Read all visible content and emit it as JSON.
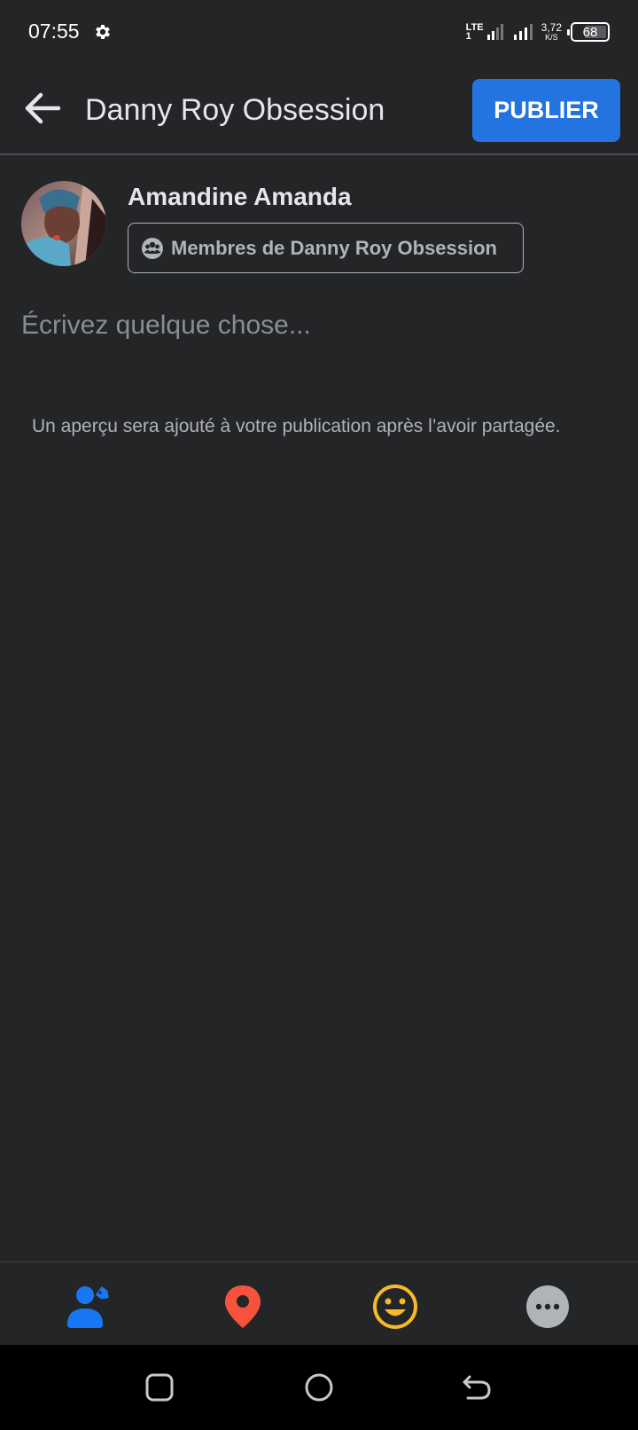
{
  "status_bar": {
    "time": "07:55",
    "network_type": "LTE",
    "network_sub": "1",
    "speed_value": "3,72",
    "speed_unit": "K/S",
    "battery_percent": "68",
    "battery_level": 0.68
  },
  "header": {
    "title": "Danny Roy Obsession",
    "publish_label": "PUBLIER"
  },
  "composer": {
    "user_name": "Amandine Amanda",
    "audience_label": "Membres de Danny Roy Obsession",
    "placeholder": "Écrivez quelque chose...",
    "preview_note": "Un aperçu sera ajouté à votre publication après l’avoir partagée."
  },
  "toolbar": {
    "items": [
      {
        "icon": "tag-people-icon",
        "color": "#1877f2"
      },
      {
        "icon": "location-pin-icon",
        "color": "#f5533d"
      },
      {
        "icon": "feeling-emoji-icon",
        "color": "#f7b928"
      },
      {
        "icon": "more-options-icon",
        "color": "#b0b3b8"
      }
    ]
  },
  "colors": {
    "background": "#242527",
    "accent": "#2374e1",
    "text_primary": "#e4e6eb",
    "text_secondary": "#b0b3b8"
  }
}
